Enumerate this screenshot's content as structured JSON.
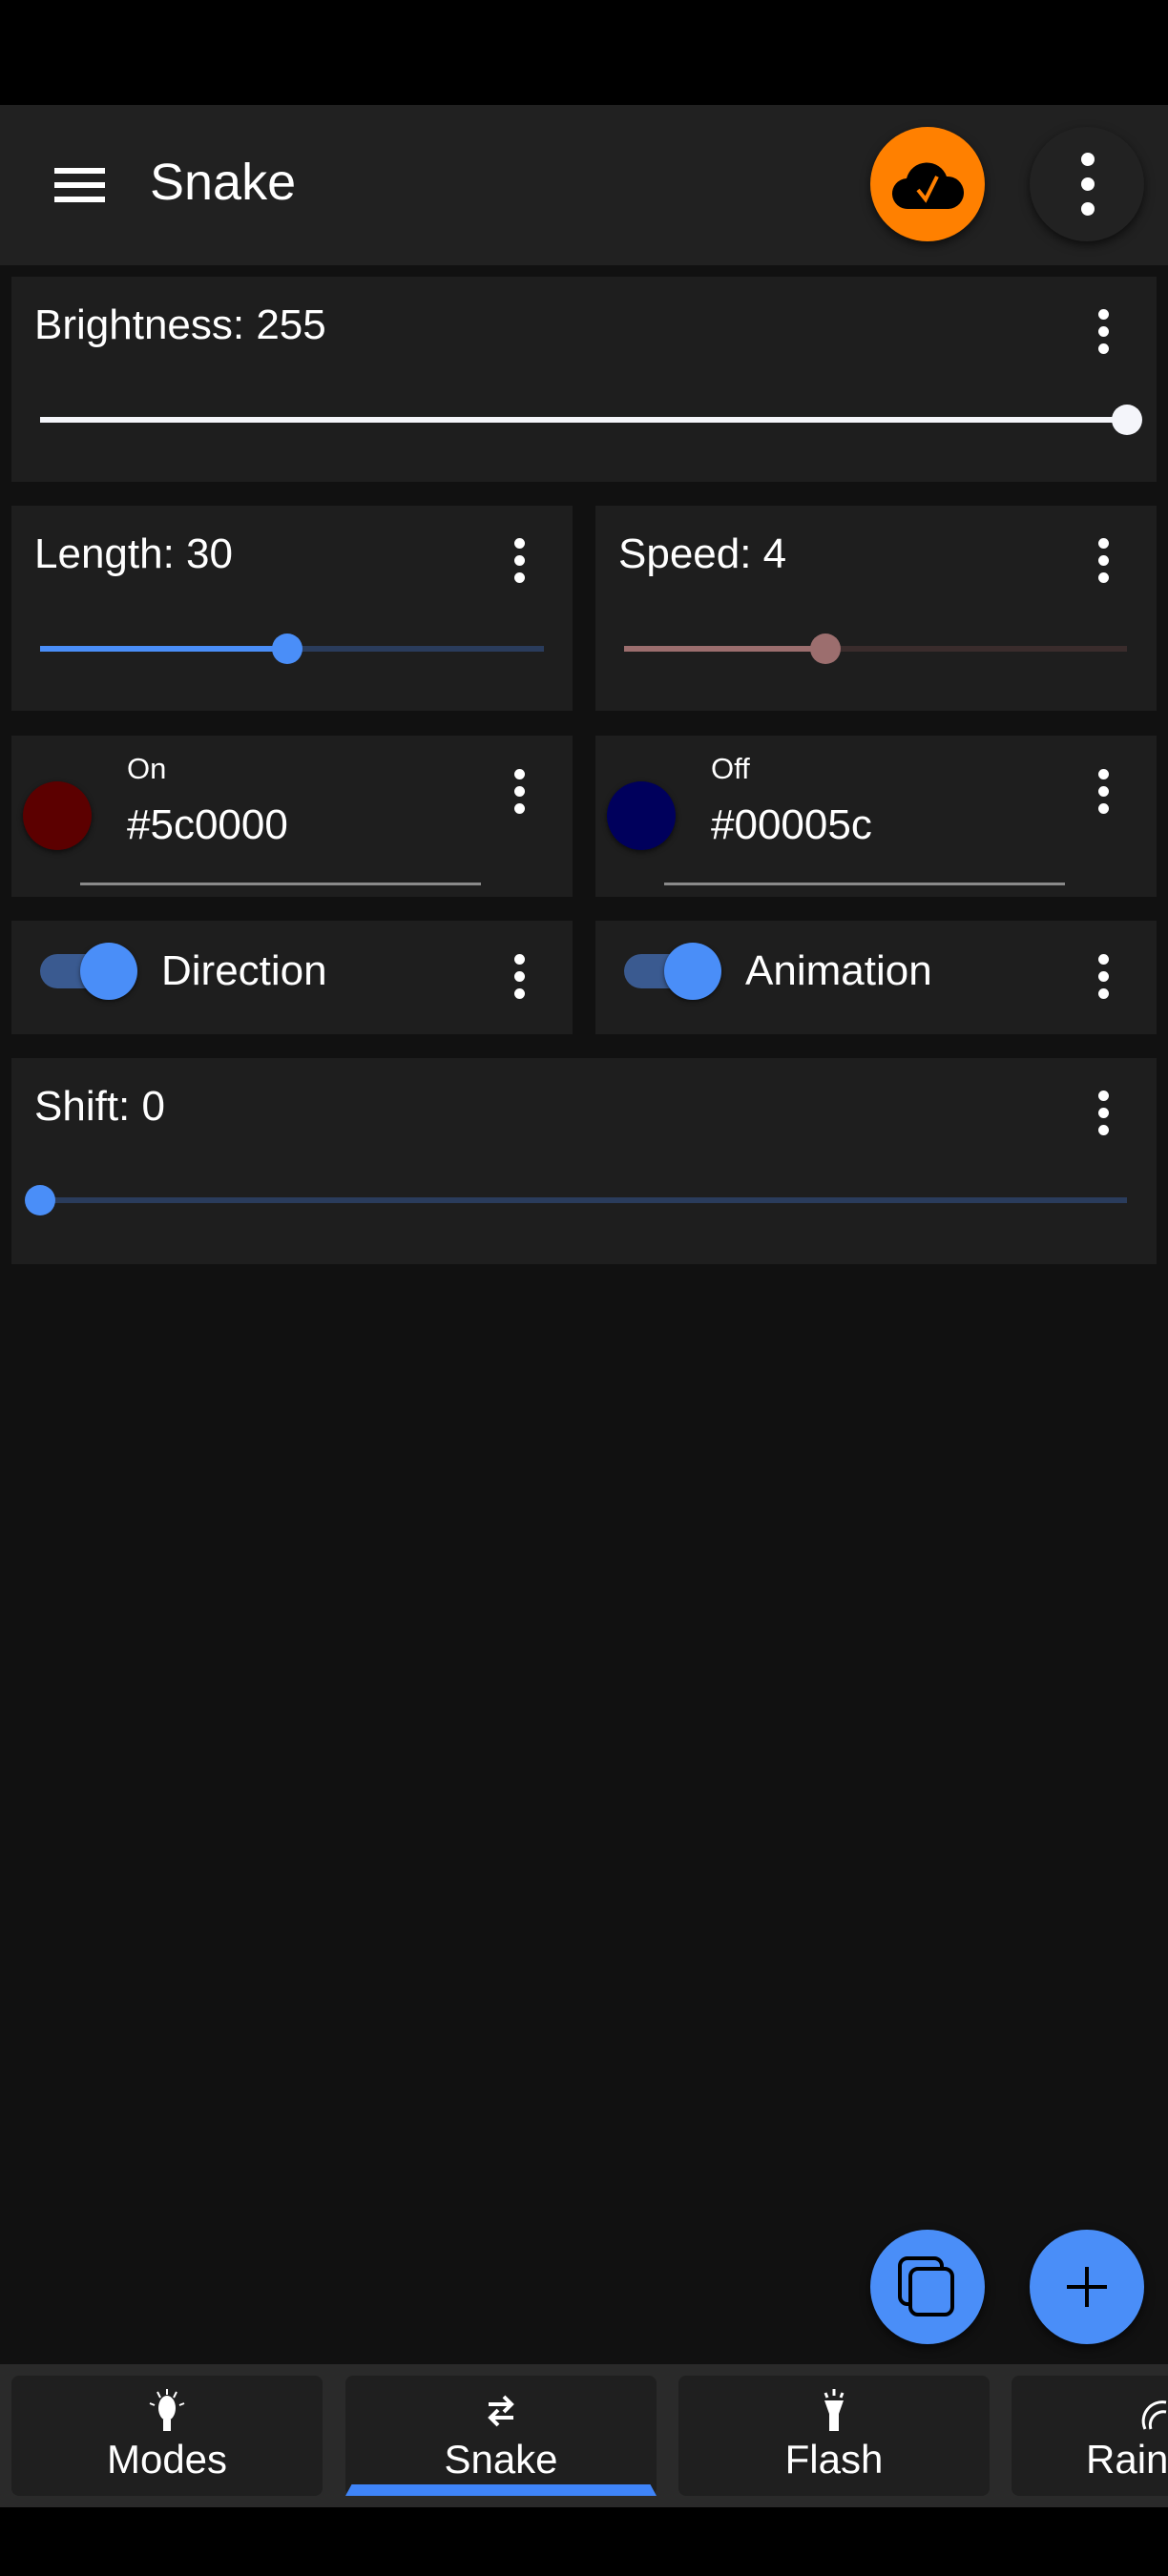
{
  "appbar": {
    "title": "Snake",
    "sync_icon": "cloud-done-icon",
    "more_icon": "more-vert-icon",
    "accent": "#ff8000"
  },
  "controls": {
    "brightness": {
      "label": "Brightness: 255",
      "value": 255,
      "fraction": 1.0,
      "color": "#f4f5fa"
    },
    "length": {
      "label": "Length: 30",
      "value": 30,
      "fraction": 0.49,
      "color": "#4a8ef8"
    },
    "speed": {
      "label": "Speed: 4",
      "value": 4,
      "fraction": 0.4,
      "color": "#9c6e6e"
    },
    "on_color": {
      "label": "On",
      "value": "#5c0000"
    },
    "off_color": {
      "label": "Off",
      "value": "#00005c"
    },
    "direction": {
      "label": "Direction",
      "checked": true
    },
    "animation": {
      "label": "Animation",
      "checked": true
    },
    "shift": {
      "label": "Shift: 0",
      "value": 0,
      "fraction": 0.0,
      "color": "#4a8ef8"
    }
  },
  "fabs": {
    "copy_icon": "copy-icon",
    "add_icon": "add-icon",
    "color": "#4a8ef8"
  },
  "nav": {
    "tabs": [
      {
        "label": "Modes",
        "icon": "lightbulb-icon"
      },
      {
        "label": "Snake",
        "icon": "swap-arrows-icon",
        "active": true
      },
      {
        "label": "Flash",
        "icon": "flashlight-icon"
      },
      {
        "label": "Rain",
        "icon": "rainbow-icon"
      }
    ],
    "active_color": "#3f84f8"
  }
}
